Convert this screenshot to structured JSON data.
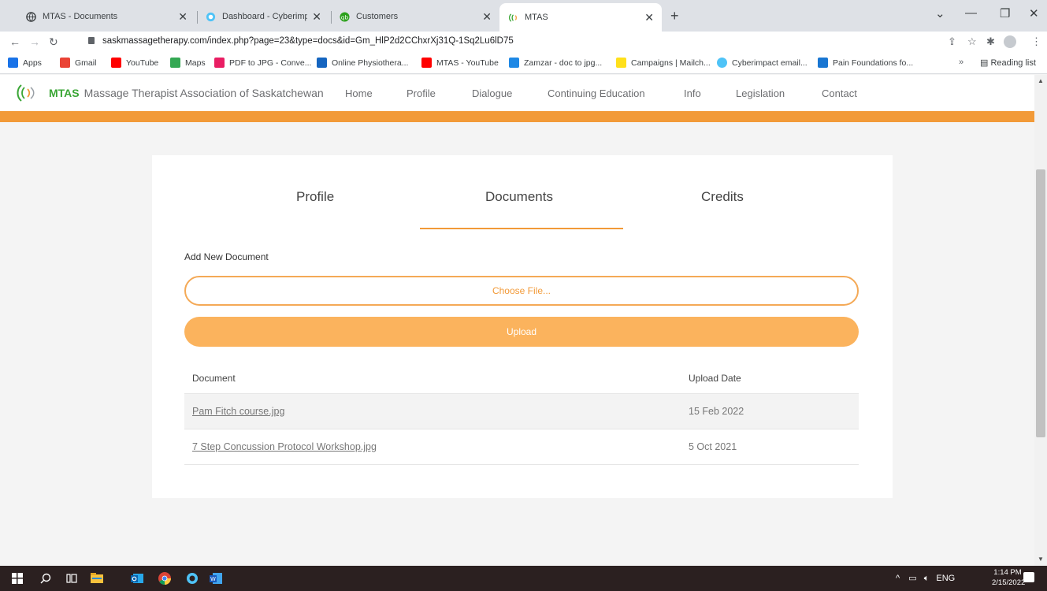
{
  "browser": {
    "tabs": [
      {
        "title": "MTAS - Documents",
        "icon": "globe-icon",
        "active": false
      },
      {
        "title": "Dashboard - Cyberimpact",
        "icon": "cyberimpact-icon",
        "active": false
      },
      {
        "title": "Customers",
        "icon": "quickbooks-icon",
        "active": false
      },
      {
        "title": "MTAS",
        "icon": "mtas-icon",
        "active": true
      }
    ],
    "url": "saskmassagetherapy.com/index.php?page=23&type=docs&id=Gm_HlP2d2CChxrXj31Q-1Sq2Lu6lD75",
    "bookmarks": [
      {
        "label": "Apps",
        "color": "#1a73e8"
      },
      {
        "label": "Gmail",
        "color": "#ea4335"
      },
      {
        "label": "YouTube",
        "color": "#ff0000"
      },
      {
        "label": "Maps",
        "color": "#34a853"
      },
      {
        "label": "PDF to JPG - Conve...",
        "color": "#e91e63"
      },
      {
        "label": "Online Physiothera...",
        "color": "#1565c0"
      },
      {
        "label": "MTAS - YouTube",
        "color": "#ff0000"
      },
      {
        "label": "Zamzar - doc to jpg...",
        "color": "#1e88e5"
      },
      {
        "label": "Campaigns | Mailch...",
        "color": "#ffe01b"
      },
      {
        "label": "Cyberimpact email...",
        "color": "#4fc3f7"
      },
      {
        "label": "Pain Foundations fo...",
        "color": "#1976d2"
      }
    ],
    "more_bookmarks": "»",
    "reading_list": "Reading list"
  },
  "site": {
    "brand_short": "MTAS",
    "brand_long": "Massage Therapist Association of Saskatchewan",
    "nav": [
      "Home",
      "Profile",
      "Dialogue",
      "Continuing Education",
      "Info",
      "Legislation",
      "Contact"
    ],
    "colors": {
      "accent": "#f29a38",
      "brand_green": "#3aa635"
    }
  },
  "page": {
    "tabs": [
      "Profile",
      "Documents",
      "Credits"
    ],
    "active_tab": "Documents",
    "add_new_label": "Add New Document",
    "choose_file_label": "Choose File...",
    "upload_label": "Upload",
    "table": {
      "headers": [
        "Document",
        "Upload Date"
      ],
      "rows": [
        {
          "document": "Pam Fitch course.jpg",
          "date": "15 Feb 2022"
        },
        {
          "document": "7 Step Concussion Protocol Workshop.jpg",
          "date": "5 Oct 2021"
        }
      ]
    }
  },
  "taskbar": {
    "language": "ENG",
    "time": "1:14 PM",
    "date": "2/15/2022"
  }
}
